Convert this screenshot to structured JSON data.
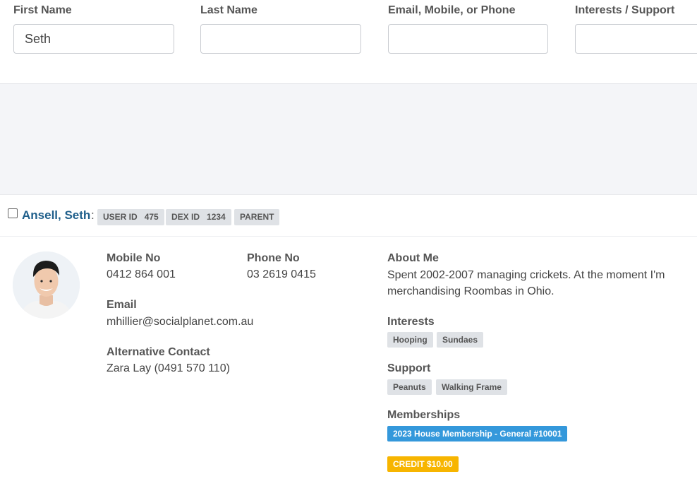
{
  "filters": {
    "first_name": {
      "label": "First Name",
      "value": "Seth",
      "placeholder": ""
    },
    "last_name": {
      "label": "Last Name",
      "value": "",
      "placeholder": ""
    },
    "contact": {
      "label": "Email, Mobile, or Phone",
      "value": "",
      "placeholder": ""
    },
    "interests": {
      "label": "Interests / Support",
      "value": "",
      "placeholder": ""
    }
  },
  "record": {
    "name": "Ansell, Seth",
    "separator": ":",
    "badges": [
      {
        "label": "USER ID",
        "value": "475"
      },
      {
        "label": "DEX ID",
        "value": "1234"
      },
      {
        "label": "PARENT",
        "value": ""
      }
    ],
    "mobile": {
      "label": "Mobile No",
      "value": "0412 864 001"
    },
    "phone": {
      "label": "Phone No",
      "value": "03 2619 0415"
    },
    "email": {
      "label": "Email",
      "value": "mhillier@socialplanet.com.au"
    },
    "alt_contact": {
      "label": "Alternative Contact",
      "value": "Zara Lay (0491 570 110)"
    },
    "about": {
      "label": "About Me",
      "value": "Spent 2002-2007 managing crickets. At the moment I'm merchandising Roombas in Ohio."
    },
    "interests": {
      "label": "Interests",
      "tags": [
        "Hooping",
        "Sundaes"
      ]
    },
    "support": {
      "label": "Support",
      "tags": [
        "Peanuts",
        "Walking Frame"
      ]
    },
    "memberships": {
      "label": "Memberships",
      "items": [
        "2023 House Membership - General #10001"
      ]
    },
    "credit": "CREDIT $10.00"
  },
  "colors": {
    "name_link": "#1f5f8b",
    "membership": "#3498db",
    "credit": "#f7b500",
    "badge_bg": "#dfe2e6"
  }
}
